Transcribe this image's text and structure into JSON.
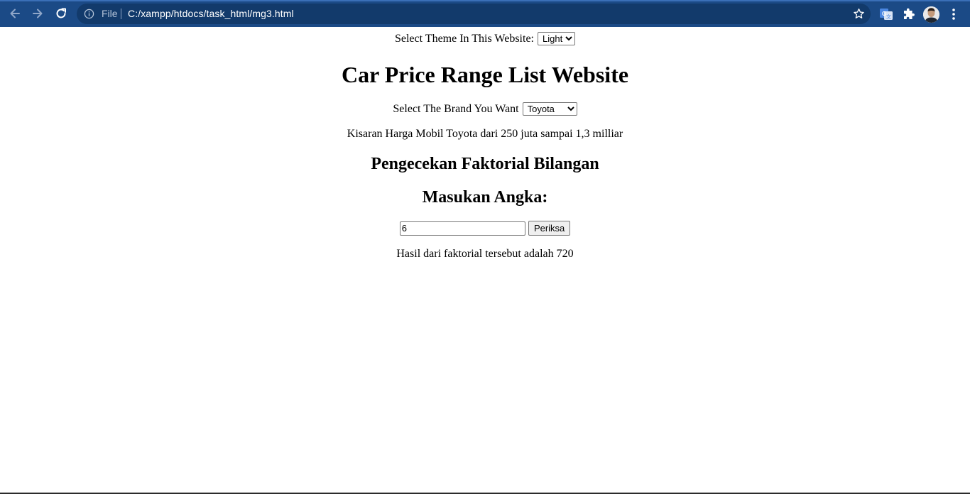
{
  "browser": {
    "url_scheme_label": "File",
    "url": "C:/xampp/htdocs/task_html/mg3.html",
    "colors": {
      "toolbar_bg": "#1b4a86",
      "omnibox_bg": "#123a6b"
    },
    "icons": [
      "back-arrow-icon",
      "forward-arrow-icon",
      "reload-icon",
      "info-icon",
      "star-icon",
      "translate-icon",
      "extensions-puzzle-icon",
      "profile-avatar",
      "menu-kebab-icon"
    ]
  },
  "theme": {
    "label": "Select Theme In This Website:",
    "selected": "Light"
  },
  "page_title": "Car Price Range List Website",
  "brand": {
    "label": "Select The Brand You Want",
    "selected": "Toyota"
  },
  "price_text": "Kisaran Harga Mobil Toyota dari 250 juta sampai 1,3 milliar",
  "factorial": {
    "heading": "Pengecekan Faktorial Bilangan",
    "input_heading": "Masukan Angka:",
    "input_value": "6",
    "button_label": "Periksa",
    "result_text": "Hasil dari faktorial tersebut adalah 720"
  }
}
